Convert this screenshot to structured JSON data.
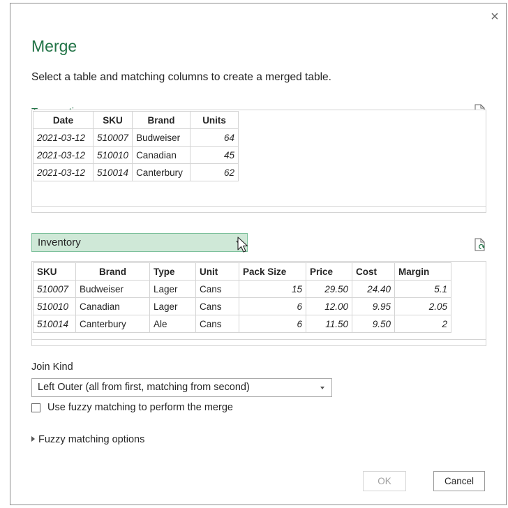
{
  "dialog": {
    "title": "Merge",
    "subtitle": "Select a table and matching columns to create a merged table.",
    "close_glyph": "×"
  },
  "first_table": {
    "label": "Transactions",
    "columns": [
      "Date",
      "SKU",
      "Brand",
      "Units"
    ],
    "rows": [
      [
        "2021-03-12",
        "510007",
        "Budweiser",
        "64"
      ],
      [
        "2021-03-12",
        "510010",
        "Canadian",
        "45"
      ],
      [
        "2021-03-12",
        "510014",
        "Canterbury",
        "62"
      ]
    ]
  },
  "second_table": {
    "selected": "Inventory",
    "columns": [
      "SKU",
      "Brand",
      "Type",
      "Unit",
      "Pack Size",
      "Price",
      "Cost",
      "Margin"
    ],
    "rows": [
      [
        "510007",
        "Budweiser",
        "Lager",
        "Cans",
        "15",
        "29.50",
        "24.40",
        "5.1"
      ],
      [
        "510010",
        "Canadian",
        "Lager",
        "Cans",
        "6",
        "12.00",
        "9.95",
        "2.05"
      ],
      [
        "510014",
        "Canterbury",
        "Ale",
        "Cans",
        "6",
        "11.50",
        "9.50",
        "2"
      ]
    ]
  },
  "join": {
    "label": "Join Kind",
    "selected": "Left Outer (all from first, matching from second)"
  },
  "fuzzy": {
    "checkbox_label": "Use fuzzy matching to perform the merge",
    "checked": false,
    "options_label": "Fuzzy matching options"
  },
  "buttons": {
    "ok": "OK",
    "cancel": "Cancel"
  },
  "icons": {
    "close": "close-icon",
    "refresh": "refresh-document-icon",
    "cursor": "mouse-pointer-icon"
  },
  "colors": {
    "accent": "#217346",
    "selected_fill": "#cfe8d7",
    "grid_border": "#d4d4d4"
  }
}
